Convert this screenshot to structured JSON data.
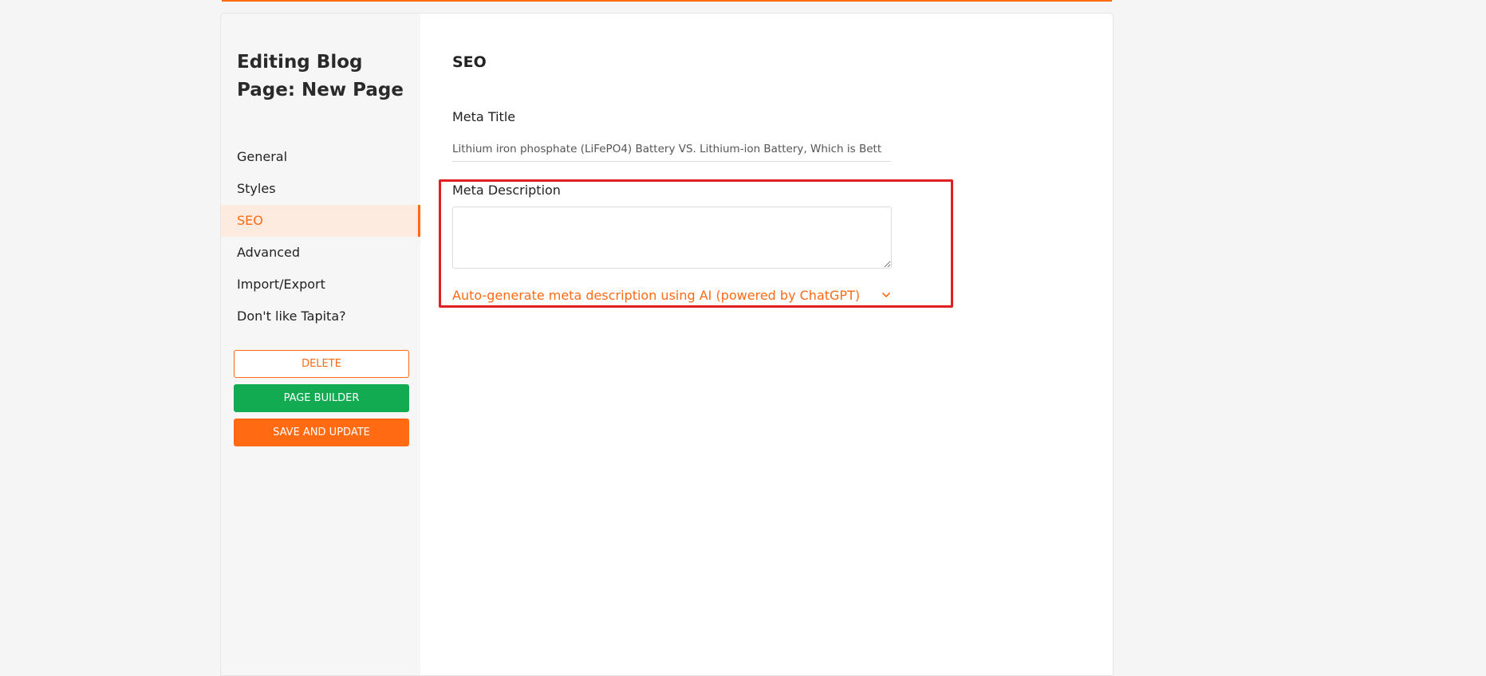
{
  "page": {
    "heading": "Editing Blog Page: New Page"
  },
  "sidebar": {
    "items": [
      {
        "label": "General"
      },
      {
        "label": "Styles"
      },
      {
        "label": "SEO",
        "active": true
      },
      {
        "label": "Advanced"
      },
      {
        "label": "Import/Export"
      },
      {
        "label": "Don't like Tapita?"
      }
    ],
    "buttons": {
      "delete": "DELETE",
      "page_builder": "PAGE BUILDER",
      "save_update": "SAVE AND UPDATE"
    }
  },
  "seo": {
    "section_title": "SEO",
    "meta_title_label": "Meta Title",
    "meta_title_value": "Lithium iron phosphate (LiFePO4) Battery VS. Lithium-ion Battery, Which is Bett",
    "meta_description_label": "Meta Description",
    "meta_description_value": "",
    "ai_generate_label": "Auto-generate meta description using AI (powered by ChatGPT)"
  },
  "colors": {
    "accent": "#ff6a13",
    "success": "#12ab52",
    "highlight": "#e02020"
  },
  "icons": {
    "ai_toggle": "chevron-down-icon"
  }
}
